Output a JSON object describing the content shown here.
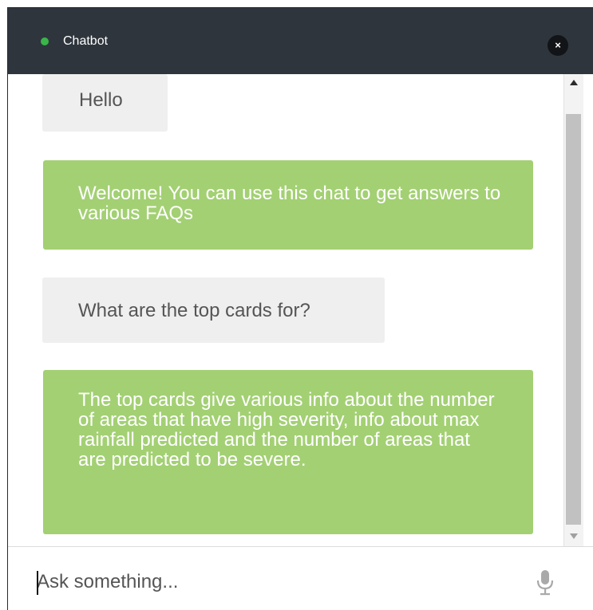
{
  "header": {
    "title": "Chatbot",
    "status_color": "#3ab54a",
    "close_label": "×",
    "close_icon": "close-icon"
  },
  "messages": [
    {
      "sender": "user",
      "text": "Hello"
    },
    {
      "sender": "bot",
      "text": "Welcome! You can use this chat to get answers to various FAQs"
    },
    {
      "sender": "user",
      "text": "What are the top cards for?"
    },
    {
      "sender": "bot",
      "text": "The top cards give various info about the number of areas that have high severity, info about max rainfall predicted and the number of areas that are predicted to be severe."
    }
  ],
  "input": {
    "placeholder": "Ask something...",
    "value": "",
    "mic_icon": "microphone-icon"
  },
  "colors": {
    "header_bg": "#2e353d",
    "bot_bubble": "#a3d073",
    "user_bubble": "#efefef"
  }
}
